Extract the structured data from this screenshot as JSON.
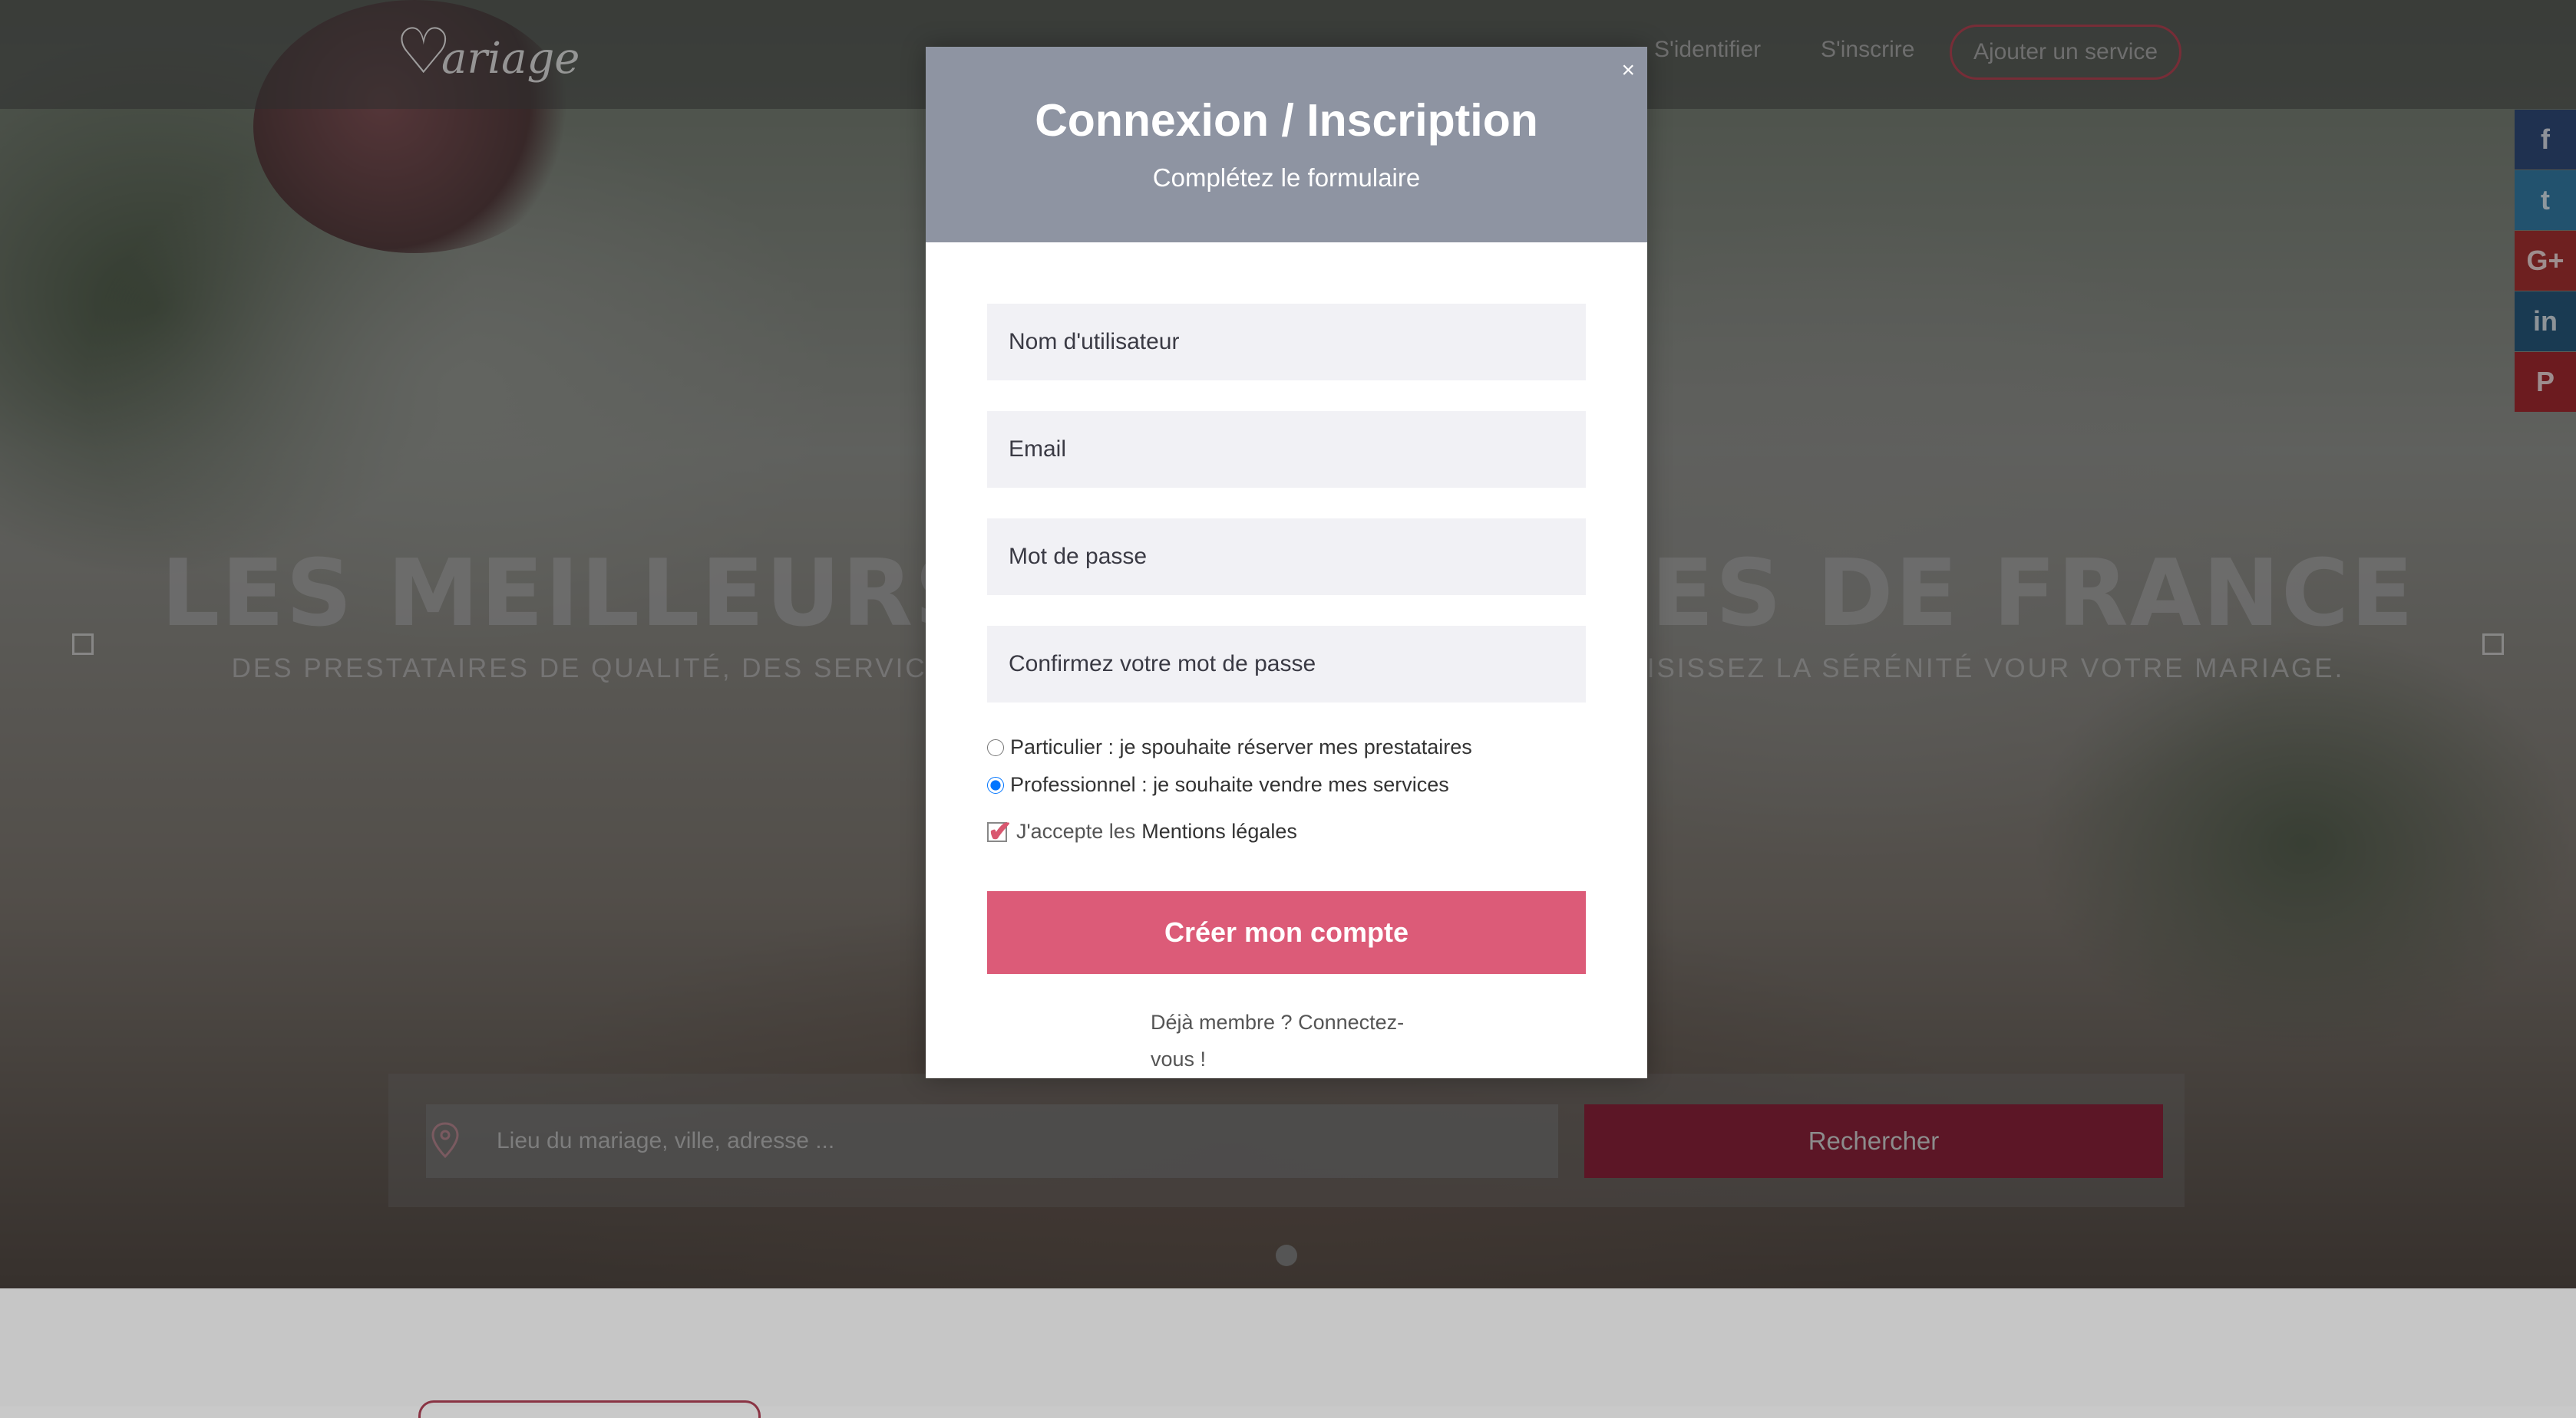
{
  "nav": {
    "logo_text": "ariage",
    "signin_label": "S'identifier",
    "signup_label": "S'inscrire",
    "add_service_label": "Ajouter un service"
  },
  "hero": {
    "title": "LES MEILLEURS PRESTATAIRES DE FRANCE",
    "subtitle": "DES PRESTATAIRES DE QUALITÉ, DES SERVICES VÉRIFIÉS, DES PAIEMENTS PROTÉGÉS, CHOISISSEZ LA SÉRÉNITÉ VOUR VOTRE MARIAGE."
  },
  "share": {
    "facebook": "f",
    "twitter": "t",
    "googleplus": "G+",
    "linkedin": "in",
    "pinterest": "P"
  },
  "search": {
    "placeholder": "Lieu du mariage, ville, adresse ...",
    "button_label": "Rechercher"
  },
  "modal": {
    "close_label": "×",
    "title": "Connexion / Inscription",
    "subtitle": "Complétez le formulaire",
    "username_placeholder": "Nom d'utilisateur",
    "email_placeholder": "Email",
    "password_placeholder": "Mot de passe",
    "confirm_placeholder": "Confirmez votre mot de passe",
    "radio_particulier": "Particulier : je spouhaite réserver mes prestataires",
    "radio_professionnel": "Professionnel : je souhaite vendre mes services",
    "accept_prefix": "J'accepte les",
    "accept_link": "Mentions légales",
    "create_button": "Créer mon compte",
    "already_member": "Déjà membre ? Connectez-vous !"
  },
  "colors": {
    "accent": "#dc5b78",
    "modal_header": "#8e94a2",
    "search_button": "#5c1626"
  },
  "icons": [
    "location-pin-icon",
    "close-icon",
    "facebook-icon",
    "twitter-icon",
    "google-plus-icon",
    "linkedin-icon",
    "pinterest-icon",
    "checkmark-icon"
  ]
}
